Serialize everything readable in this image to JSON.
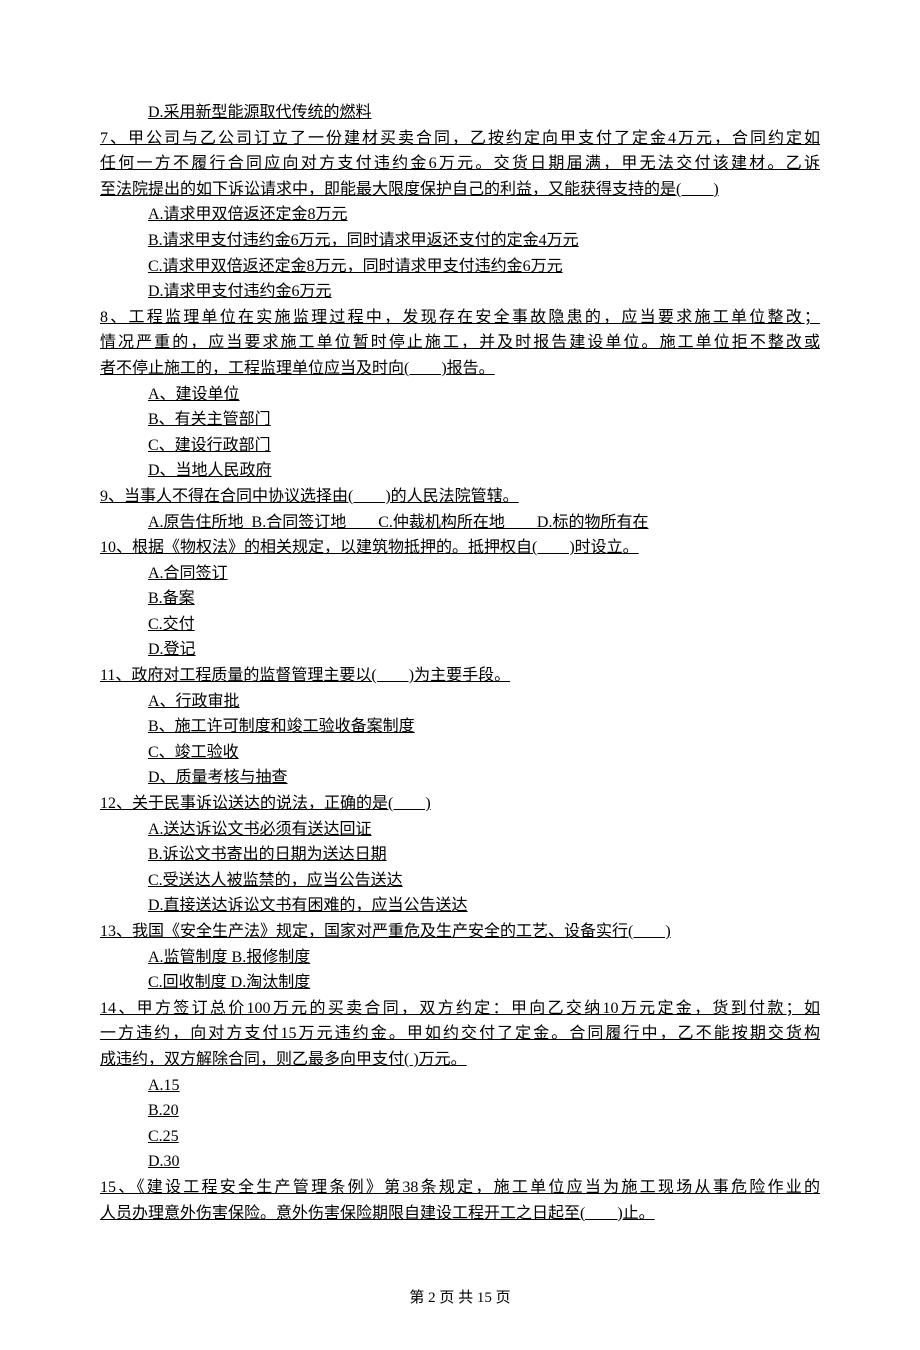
{
  "q6": {
    "d": "D.采用新型能源取代传统的燃料"
  },
  "q7": {
    "stem1": "7、甲公司与乙公司订立了一份建材买卖合同，乙按约定向甲支付了定金4万元，合同约定如",
    "stem2": "任何一方不履行合同应向对方支付违约金6万元。交货日期届满，甲无法交付该建材。乙诉",
    "stem3": "至法院提出的如下诉讼请求中，即能最大限度保护自己的利益，又能获得支持的是(　　)",
    "a": "A.请求甲双倍返还定金8万元",
    "b": "B.请求甲支付违约金6万元，同时请求甲返还支付的定金4万元",
    "c": "C.请求甲双倍返还定金8万元，同时请求甲支付违约金6万元",
    "d": "D.请求甲支付违约金6万元"
  },
  "q8": {
    "stem1": "8、工程监理单位在实施监理过程中，发现存在安全事故隐患的，应当要求施工单位整改；",
    "stem2": "情况严重的，应当要求施工单位暂时停止施工，并及时报告建设单位。施工单位拒不整改或",
    "stem3": "者不停止施工的，工程监理单位应当及时向(　　)报告。",
    "a": "A、建设单位",
    "b": "B、有关主管部门",
    "c": "C、建设行政部门",
    "d": "D、当地人民政府"
  },
  "q9": {
    "stem": "9、当事人不得在合同中协议选择由(　　)的人民法院管辖。",
    "opts": "A.原告住所地  B.合同签订地　　C.仲裁机构所在地　　D.标的物所有在"
  },
  "q10": {
    "stem": "10、根据《物权法》的相关规定，以建筑物抵押的。抵押权自(　　)时设立。",
    "a": "A.合同签订",
    "b": "B.备案",
    "c": "C.交付",
    "d": "D.登记"
  },
  "q11": {
    "stem": "11、政府对工程质量的监督管理主要以(　　)为主要手段。",
    "a": "A、行政审批",
    "b": "B、施工许可制度和竣工验收备案制度",
    "c": "C、竣工验收",
    "d": "D、质量考核与抽查"
  },
  "q12": {
    "stem": "12、关于民事诉讼送达的说法，正确的是(　　)",
    "a": "A.送达诉讼文书必须有送达回证",
    "b": "B.诉讼文书寄出的日期为送达日期",
    "c": "C.受送达人被监禁的，应当公告送达",
    "d": "D.直接送达诉讼文书有困难的，应当公告送达"
  },
  "q13": {
    "stem": "13、我国《安全生产法》规定，国家对严重危及生产安全的工艺、设备实行(　　)",
    "ab": "A.监管制度 B.报修制度",
    "cd": "C.回收制度 D.淘汰制度"
  },
  "q14": {
    "stem1": "14、甲方签订总价100万元的买卖合同，双方约定：甲向乙交纳10万元定金，货到付款；如",
    "stem2": "一方违约，向对方支付15万元违约金。甲如约交付了定金。合同履行中，乙不能按期交货构",
    "stem3": "成违约，双方解除合同，则乙最多向甲支付( )万元。",
    "a": "A.15",
    "b": "B.20",
    "c": "C.25",
    "d": "D.30"
  },
  "q15": {
    "stem1": "15、《建设工程安全生产管理条例》第38条规定，施工单位应当为施工现场从事危险作业的",
    "stem2": "人员办理意外伤害保险。意外伤害保险期限自建设工程开工之日起至(　　)止。"
  },
  "footer": "第 2 页 共 15 页"
}
